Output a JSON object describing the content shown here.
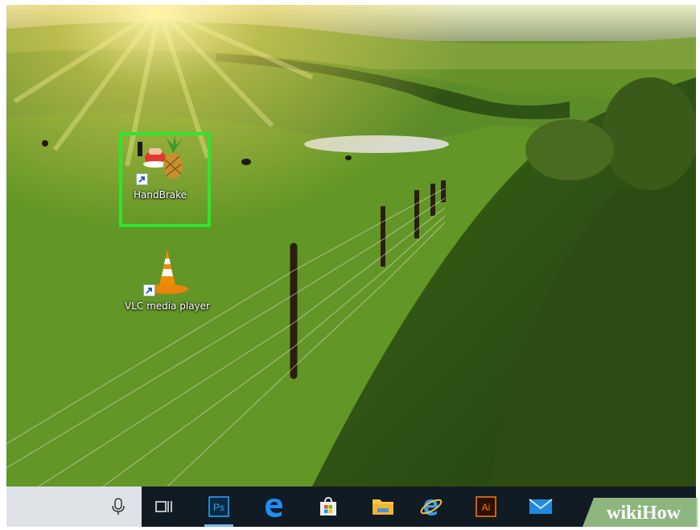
{
  "desktop": {
    "icons": [
      {
        "label": "HandBrake",
        "icon": "handbrake-pineapple-icon",
        "selected": true
      },
      {
        "label": "VLC media player",
        "icon": "vlc-cone-icon",
        "selected": false
      }
    ],
    "highlight_color": "#2ee62e"
  },
  "taskbar": {
    "buttons": [
      {
        "name": "task-view",
        "icon": "task-view-icon"
      },
      {
        "name": "photoshop",
        "icon": "photoshop-icon",
        "text": "Ps",
        "active": true
      },
      {
        "name": "edge",
        "icon": "edge-icon"
      },
      {
        "name": "store",
        "icon": "store-bag-icon"
      },
      {
        "name": "file-explorer",
        "icon": "folder-icon"
      },
      {
        "name": "internet-explorer",
        "icon": "internet-explorer-icon"
      },
      {
        "name": "illustrator",
        "icon": "illustrator-icon",
        "text": "Ai"
      },
      {
        "name": "mail",
        "icon": "mail-envelope-icon"
      }
    ],
    "colors": {
      "bar": "#111b24",
      "search": "#dfe3e8",
      "active_underline": "#76b9ed"
    }
  },
  "watermark": {
    "text": "wikiHow"
  }
}
